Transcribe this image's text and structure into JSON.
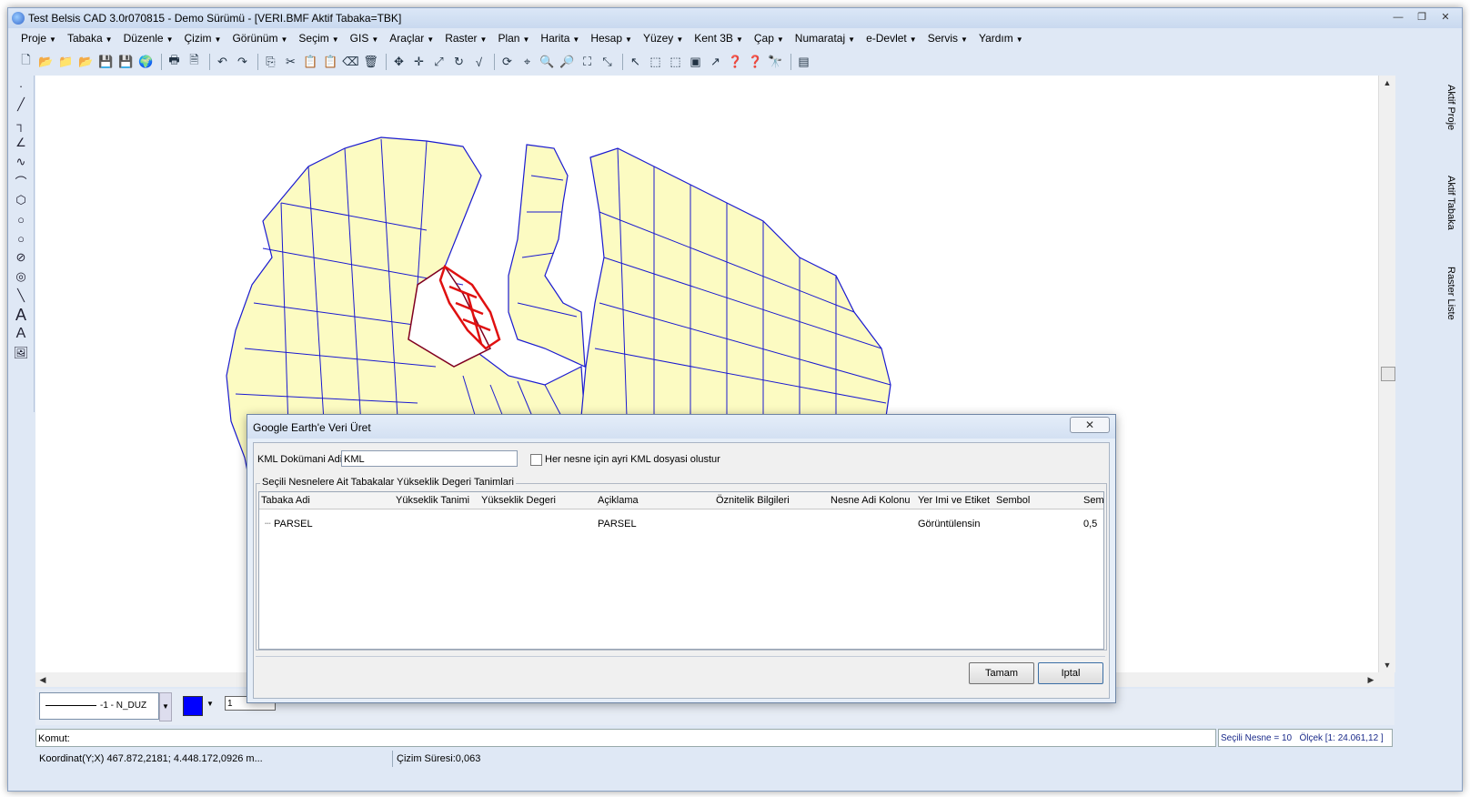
{
  "window": {
    "title": "Test Belsis CAD 3.0r070815 - Demo Sürümü - [VERI.BMF  Aktif Tabaka=TBK]"
  },
  "menu": [
    "Proje",
    "Tabaka",
    "Düzenle",
    "Çizim",
    "Görünüm",
    "Seçim",
    "GIS",
    "Araçlar",
    "Raster",
    "Plan",
    "Harita",
    "Hesap",
    "Yüzey",
    "Kent 3B",
    "Çap",
    "Numarataj",
    "e-Devlet",
    "Servis",
    "Yardım"
  ],
  "right_panel": {
    "tab1": "Aktif Proje",
    "tab2": "Aktif Tabaka",
    "tab3": "Raster Liste"
  },
  "bottom_tools": {
    "linetype": "-1 - N_DUZ",
    "line_width": "1",
    "color": "#0000ff"
  },
  "command": {
    "label": "Komut:",
    "selected": "Seçili Nesne = 10",
    "scale": "Ölçek [1: 24.061,12 ]"
  },
  "status": {
    "coords": "Koordinat(Y;X)  467.872,2181; 4.448.172,0926 m...",
    "draw_time": "Çizim Süresi:0,063"
  },
  "dialog": {
    "title": "Google Earth'e Veri Üret",
    "kml_label": "KML Dokümani Adi",
    "kml_value": "KML",
    "checkbox_label": "Her nesne için ayri KML dosyasi olustur",
    "group_label": "Seçili Nesnelere Ait Tabakalar Yükseklik Degeri Tanimlari",
    "columns": [
      "Tabaka Adi",
      "Yükseklik Tanimi",
      "Yükseklik Degeri",
      "Açiklama",
      "Öznitelik Bilgileri",
      "Nesne Adi Kolonu",
      "Yer Imi ve Etiket",
      "Sembol",
      "Sembo"
    ],
    "row": {
      "tabaka": "PARSEL",
      "aciklama": "PARSEL",
      "yerimi": "Görüntülensin",
      "sembol": "0,5"
    },
    "ok": "Tamam",
    "cancel": "Iptal"
  }
}
